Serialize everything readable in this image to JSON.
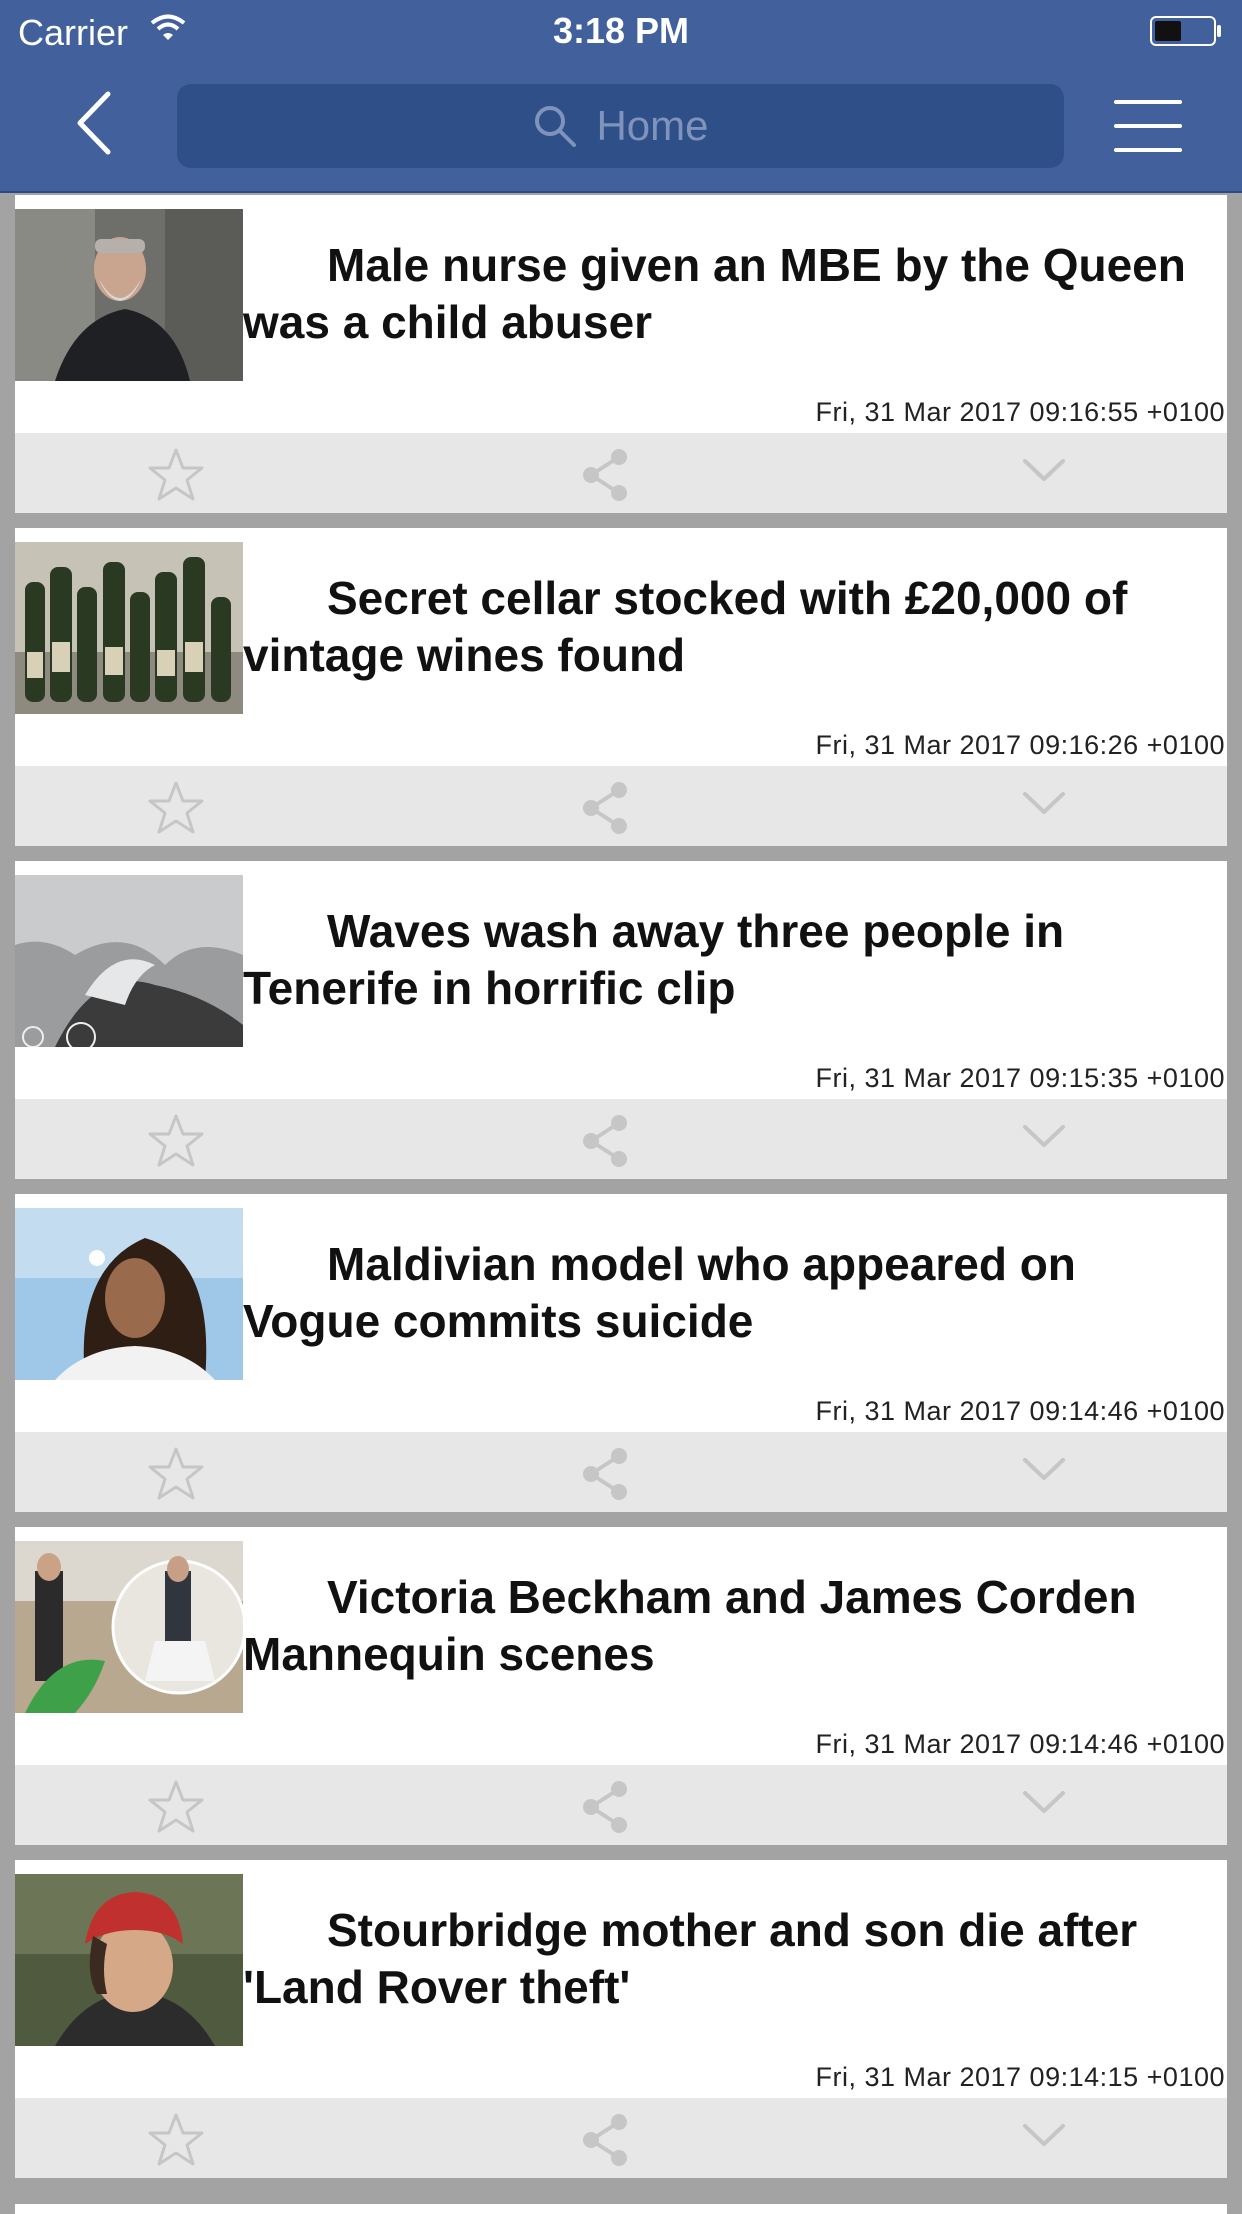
{
  "status_bar": {
    "carrier": "Carrier",
    "time": "3:18 PM"
  },
  "nav": {
    "search_placeholder": "Home"
  },
  "articles": [
    {
      "headline": "Male nurse given an MBE by the Queen was a child abuser",
      "timestamp": "Fri, 31 Mar 2017 09:16:55 +0100",
      "thumbnail": "older-man-portrait"
    },
    {
      "headline": "Secret cellar stocked with £20,000 of vintage wines found",
      "timestamp": "Fri, 31 Mar 2017 09:16:26 +0100",
      "thumbnail": "wine-bottles"
    },
    {
      "headline": "Waves wash away three people in Tenerife in horrific clip",
      "timestamp": "Fri, 31 Mar 2017 09:15:35 +0100",
      "thumbnail": "crashing-waves"
    },
    {
      "headline": "Maldivian model who appeared on Vogue commits suicide",
      "timestamp": "Fri, 31 Mar 2017 09:14:46 +0100",
      "thumbnail": "model-portrait"
    },
    {
      "headline": "Victoria Beckham and James Corden Mannequin scenes",
      "timestamp": "Fri, 31 Mar 2017 09:14:46 +0100",
      "thumbnail": "mannequin-scenes"
    },
    {
      "headline": "Stourbridge mother and son die after 'Land Rover theft'",
      "timestamp": "Fri, 31 Mar 2017 09:14:15 +0100",
      "thumbnail": "woman-in-helmet"
    }
  ],
  "colors": {
    "nav_background": "#42609b",
    "search_field": "#2e4f88",
    "action_bar": "#e7e7e7",
    "feed_background": "#a3a3a3"
  }
}
